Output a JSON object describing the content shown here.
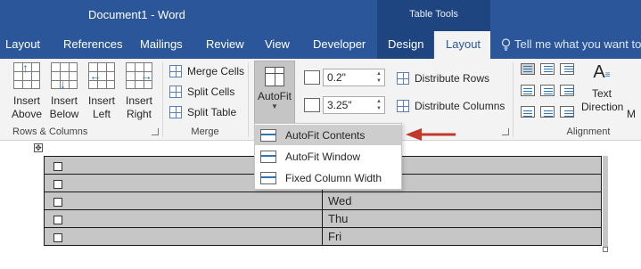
{
  "titlebar": {
    "document_title": "Document1 - Word",
    "context_tab_group": "Table Tools"
  },
  "tabs": [
    {
      "label": "Layout"
    },
    {
      "label": "References"
    },
    {
      "label": "Mailings"
    },
    {
      "label": "Review"
    },
    {
      "label": "View"
    },
    {
      "label": "Developer"
    },
    {
      "label": "Design"
    },
    {
      "label": "Layout"
    }
  ],
  "tell_me": {
    "text": "Tell me what you want to"
  },
  "ribbon": {
    "rows_columns": {
      "label": "Rows & Columns",
      "insert_above": "Insert\nAbove",
      "insert_below": "Insert\nBelow",
      "insert_left": "Insert\nLeft",
      "insert_right": "Insert\nRight"
    },
    "merge": {
      "label": "Merge",
      "merge_cells": "Merge Cells",
      "split_cells": "Split Cells",
      "split_table": "Split Table"
    },
    "cell_size": {
      "autofit": "AutoFit",
      "height_value": "0.2\"",
      "width_value": "3.25\"",
      "distribute_rows": "Distribute Rows",
      "distribute_columns": "Distribute Columns"
    },
    "alignment": {
      "label": "Alignment",
      "text_direction": "Text\nDirection",
      "cell_margins_partial": "M"
    }
  },
  "autofit_menu": {
    "items": [
      {
        "label": "AutoFit Contents",
        "highlighted": true
      },
      {
        "label": "AutoFit Window",
        "highlighted": false
      },
      {
        "label": "Fixed Column Width",
        "highlighted": false
      }
    ]
  },
  "document_table": {
    "rows": [
      {
        "col2": ""
      },
      {
        "col2": ""
      },
      {
        "col2": "Wed"
      },
      {
        "col2": "Thu"
      },
      {
        "col2": "Fri"
      }
    ]
  },
  "colors": {
    "title_bar": "#2b579a",
    "context_tab": "#1e4580",
    "ribbon_bg": "#f3f3f3",
    "selection": "#c6c6c6",
    "arrow": "#c0392b"
  }
}
